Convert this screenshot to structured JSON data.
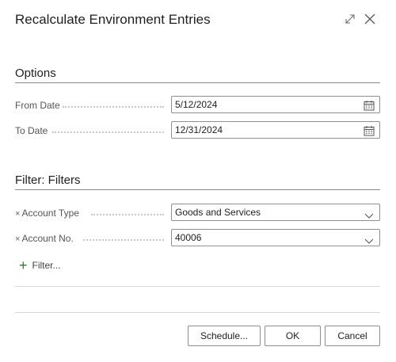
{
  "dialog": {
    "title": "Recalculate Environment Entries",
    "expand_icon": "expand-icon",
    "close_icon": "close-icon"
  },
  "options": {
    "section_title": "Options",
    "from_date": {
      "label": "From Date",
      "value": "5/12/2024",
      "icon": "calendar-icon"
    },
    "to_date": {
      "label": "To Date",
      "value": "12/31/2024",
      "icon": "calendar-icon"
    }
  },
  "filters": {
    "section_title": "Filter: Filters",
    "account_type": {
      "remove_glyph": "×",
      "label": "Account Type",
      "value": "Goods and Services",
      "icon": "chevron-down-icon"
    },
    "account_no": {
      "remove_glyph": "×",
      "label": "Account No.",
      "value": "40006",
      "icon": "chevron-down-icon"
    },
    "add_filter": {
      "icon": "plus-icon",
      "label": "Filter..."
    }
  },
  "buttons": {
    "schedule": "Schedule...",
    "ok": "OK",
    "cancel": "Cancel"
  },
  "colors": {
    "accent_green": "#2e7d32",
    "border": "#8f8f8f"
  }
}
